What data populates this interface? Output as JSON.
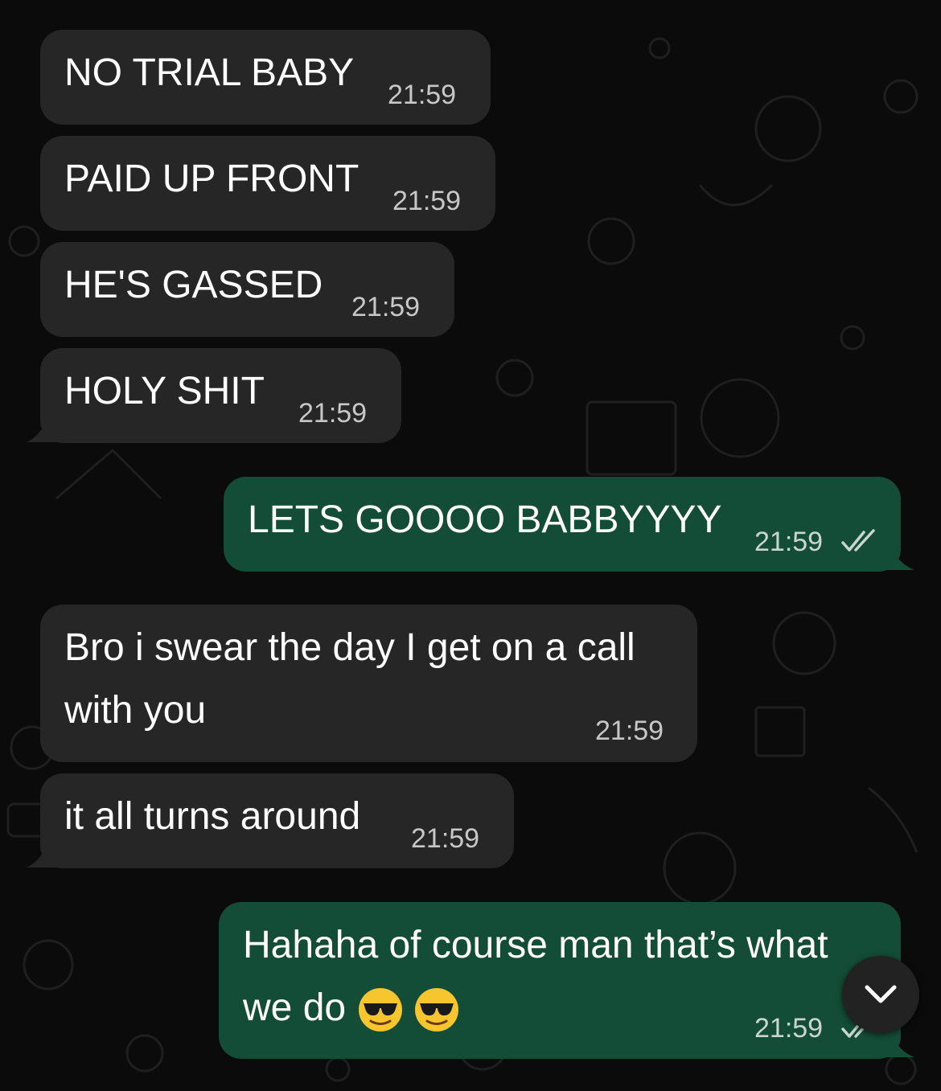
{
  "colors": {
    "background": "#0b0b0b",
    "incoming_bubble": "#262626",
    "outgoing_bubble": "#144d37",
    "read_tick": "#c9d6cf"
  },
  "messages": [
    {
      "direction": "incoming",
      "text": "NO TRIAL BABY",
      "time": "21:59"
    },
    {
      "direction": "incoming",
      "text": "PAID UP FRONT",
      "time": "21:59"
    },
    {
      "direction": "incoming",
      "text": "HE'S GASSED",
      "time": "21:59"
    },
    {
      "direction": "incoming",
      "text": "HOLY SHIT",
      "time": "21:59"
    },
    {
      "direction": "outgoing",
      "text": "LETS GOOOO BABBYYYY",
      "time": "21:59",
      "status_icon": "double-check-icon"
    },
    {
      "direction": "incoming",
      "text_line1": "Bro i swear the day I get on a call",
      "text_line2": "with you",
      "time": "21:59"
    },
    {
      "direction": "incoming",
      "text": "it all turns around",
      "time": "21:59"
    },
    {
      "direction": "outgoing",
      "text_line1": "Hahaha of course man that’s what",
      "text_line2": "we do",
      "emoji": [
        "smiling-face-with-sunglasses",
        "smiling-face-with-sunglasses"
      ],
      "time": "21:59",
      "status_icon": "double-check-icon"
    }
  ],
  "scroll_button": {
    "icon": "chevron-down-icon"
  }
}
